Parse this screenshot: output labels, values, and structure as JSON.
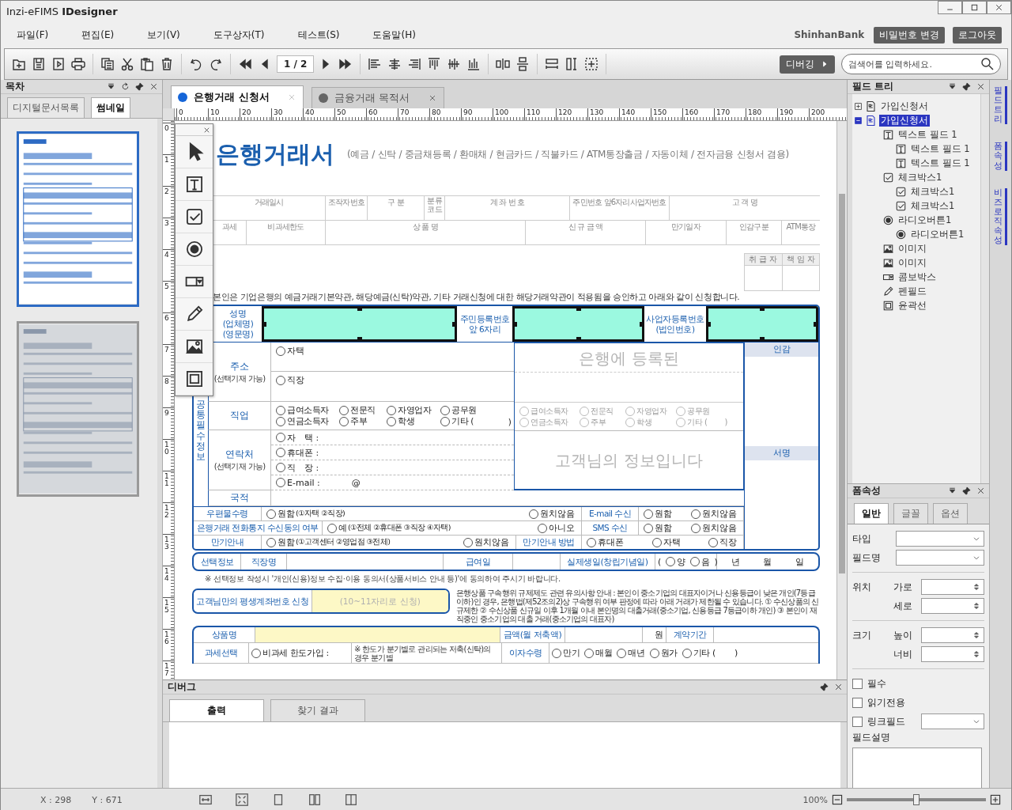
{
  "window": {
    "title": "Inzi-eFIMS **IDesigner**"
  },
  "menu": [
    "파일(F)",
    "편집(E)",
    "보기(V)",
    "도구상자(T)",
    "테스트(S)",
    "도움말(H)"
  ],
  "account": {
    "user": "ShinhanBank",
    "buttons": [
      "비밀번호 변경",
      "로그아웃"
    ]
  },
  "toolbar": {
    "page": "1 / 2",
    "debug_button": "디버깅",
    "search": {
      "placeholder": "검색어를 입력하세요."
    }
  },
  "left_panel": {
    "title": "목차",
    "tabs": [
      {
        "label": "디지털문서목록",
        "selected": false
      },
      {
        "label": "썸네일",
        "selected": true
      }
    ],
    "thumbnails": [
      {
        "selected": true
      },
      {
        "selected": false
      }
    ]
  },
  "doc_tabs": [
    {
      "label": "은행거래 신청서",
      "selected": true
    },
    {
      "label": "금융거래 목적서",
      "selected": false
    }
  ],
  "ruler": {
    "horizontal": [
      "0",
      "10",
      "20",
      "30",
      "40",
      "50",
      "60",
      "70",
      "80",
      "90",
      "100",
      "110",
      "120",
      "130",
      "140",
      "150",
      "160",
      "170",
      "180",
      "190",
      "200"
    ],
    "vertical": [
      "0",
      "1",
      "2",
      "3",
      "4",
      "5",
      "6",
      "7",
      "8",
      "9",
      "10",
      "11",
      "12",
      "13",
      "14",
      "15",
      "16",
      "17"
    ]
  },
  "document": {
    "title": "은행거래서",
    "subtitle": "(예금 / 신탁 / 중금채등록 / 환매채 / 현금카드 / 직불카드 / ATM통장출금 / 자동이체 / 전자금융 신청서 겸용)",
    "bank_use_table": [
      [
        "거래일시",
        "조작자번호",
        "구 분",
        "분류코드",
        "계 좌 번 호",
        "주민번호 앞6자리사업자번호",
        "고 객 명"
      ],
      [
        "과세",
        "비과세한도",
        "상 품 명",
        "신 규 금 액",
        "만기일자",
        "인감구분",
        "ATM통장"
      ]
    ],
    "approval": [
      "취 급 자",
      "책 임 자"
    ],
    "statement": "본인은 기업은행의 예금거래기본약관, 해당예금(신탁)약관, 기타 거래신청에 대한 해당거래약관이 적용됨을 승인하고 아래와 같이 신청합니다.",
    "identity": [
      {
        "kind": "label",
        "text": "성명\n(업체명)\n(영문명)"
      },
      {
        "kind": "field"
      },
      {
        "kind": "label",
        "text": "주민등록번호\n앞 6자리"
      },
      {
        "kind": "field"
      },
      {
        "kind": "label",
        "text": "사업자등록번호\n(법인번호)"
      },
      {
        "kind": "field"
      }
    ],
    "section_label": "공통필수정보",
    "address": {
      "label": "주소",
      "note": "(선택기재 가능)",
      "options": [
        {
          "label": "자택",
          "selected": false
        },
        {
          "label": "직장",
          "selected": false
        }
      ]
    },
    "job": {
      "label": "직업",
      "options": [
        {
          "label": "급여소득자",
          "selected": false
        },
        {
          "label": "전문직",
          "selected": false
        },
        {
          "label": "자영업자",
          "selected": false
        },
        {
          "label": "공무원",
          "selected": false
        },
        {
          "label": "연금소득자",
          "selected": false
        },
        {
          "label": "주부",
          "selected": false
        },
        {
          "label": "학생",
          "selected": false
        },
        {
          "label": "기타 (",
          "suffix": ")",
          "selected": false
        }
      ]
    },
    "contact": {
      "label": "연락처",
      "note": "(선택기재 가능)",
      "options": [
        {
          "label": "자　택 :",
          "selected": false
        },
        {
          "label": "휴대폰 :",
          "selected": false
        },
        {
          "label": "직　장 :",
          "selected": false
        },
        {
          "label": "E-mail :",
          "suffix": "@",
          "selected": false
        }
      ]
    },
    "nationality": {
      "label": "국적"
    },
    "registered_info": {
      "watermarks": [
        "은행에 등록된",
        "고객님의 정보입니다"
      ],
      "options": [
        {
          "label": "급여소득자",
          "selected": false
        },
        {
          "label": "전문직",
          "selected": false
        },
        {
          "label": "자영업자",
          "selected": false
        },
        {
          "label": "공무원",
          "selected": false
        },
        {
          "label": "연금소득자",
          "selected": false
        },
        {
          "label": "주부",
          "selected": false
        },
        {
          "label": "학생",
          "selected": false
        },
        {
          "label": "기타 (",
          "suffix": ")",
          "selected": false
        }
      ]
    },
    "seal": [
      "인감",
      "서명"
    ],
    "consent_rows": [
      {
        "cells": [
          {
            "kind": "label",
            "text": "우편물수령"
          },
          {
            "kind": "radios",
            "options": [
              {
                "label": "원함",
                "note": "(①자택 ②직장)",
                "selected": false
              },
              {
                "label": "원치않음",
                "selected": false
              }
            ]
          },
          {
            "kind": "label",
            "text": "E-mail 수신"
          },
          {
            "kind": "radios",
            "options": [
              {
                "label": "원함",
                "selected": false
              },
              {
                "label": "원치않음",
                "selected": false
              }
            ]
          }
        ]
      },
      {
        "cells": [
          {
            "kind": "label",
            "text": "은행거래 전화통지 수신동의 여부"
          },
          {
            "kind": "radios",
            "options": [
              {
                "label": "예",
                "note": "(①전체 ②휴대폰 ③직장 ④자택)",
                "selected": false
              },
              {
                "label": "아니오",
                "selected": false
              }
            ]
          },
          {
            "kind": "label",
            "text": "SMS 수신"
          },
          {
            "kind": "radios",
            "options": [
              {
                "label": "원함",
                "selected": false
              },
              {
                "label": "원치않음",
                "selected": false
              }
            ]
          }
        ]
      },
      {
        "cells": [
          {
            "kind": "label",
            "text": "만기안내"
          },
          {
            "kind": "radios",
            "options": [
              {
                "label": "원함",
                "note": "(①고객센터 ②영업점 ③전체)",
                "selected": false
              },
              {
                "label": "원치않음",
                "selected": false
              }
            ]
          },
          {
            "kind": "label",
            "text": "만기안내 방법"
          },
          {
            "kind": "radios",
            "options": [
              {
                "label": "휴대폰",
                "selected": false
              },
              {
                "label": "자택",
                "selected": false
              },
              {
                "label": "직장",
                "selected": false
              }
            ]
          }
        ]
      }
    ],
    "optional_row": [
      {
        "kind": "label",
        "text": "선택정보"
      },
      {
        "kind": "label",
        "text": "직장명"
      },
      {
        "kind": "blank"
      },
      {
        "kind": "label",
        "text": "급여일"
      },
      {
        "kind": "blank"
      },
      {
        "kind": "label",
        "text": "실제생일(창립기념일)"
      },
      {
        "kind": "radios",
        "prefix": "(",
        "suffix": ")",
        "options": [
          {
            "label": "양",
            "selected": false
          },
          {
            "label": "음",
            "selected": false
          }
        ]
      },
      {
        "kind": "date",
        "parts": [
          "년",
          "월",
          "일"
        ]
      }
    ],
    "optional_note": "※ 선택정보 작성시 '개인(신용)정보 수집·이용 동의서(상품서비스 안내 등)'에 동의하여 주시기 바랍니다.",
    "lifetime_account": {
      "label": "고객님만의 평생계좌번호 신청",
      "placeholder": "(10~11자리로 신청)"
    },
    "notice": "은행상품 구속행위 규제제도 관련 유의사항 안내 :  본인이 중소기업의 대표자이거나 신용등급이 낮은 개인(7등급 이하)인 경우, 은행법(제52조의2)상 구속행위 여부 판정에 따라 아래 거래가 제한될 수 있습니다.  ① 수신상품의 신규제한  ② 수신상품 신규일 이후 1개월 이내 본인명의 대출거래(중소기업, 신용등급 7등급이하 개인)  ③ 본인이 재직중인 중소기업의 대출 거래(중소기업의 대표자)",
    "product_rows": [
      [
        {
          "kind": "label",
          "text": "상품명"
        },
        {
          "kind": "field"
        },
        {
          "kind": "label",
          "text": "금액(월 저축액)"
        },
        {
          "kind": "blank"
        },
        {
          "kind": "text",
          "text": "원"
        },
        {
          "kind": "label",
          "text": "계약기간"
        },
        {
          "kind": "blank"
        }
      ],
      [
        {
          "kind": "label",
          "text": "과세선택"
        },
        {
          "kind": "radios",
          "options": [
            {
              "label": "비과세 한도가입 :",
              "selected": false
            }
          ]
        },
        {
          "kind": "note",
          "text": "※ 한도가 분기별로 관리되는 저축(신탁)의 경우 분기별"
        },
        {
          "kind": "label",
          "text": "이자수령"
        },
        {
          "kind": "radios",
          "options": [
            {
              "label": "만기",
              "selected": false
            },
            {
              "label": "매월",
              "selected": false
            },
            {
              "label": "매년",
              "selected": false
            },
            {
              "label": "원가",
              "selected": false
            },
            {
              "label": "기타 (",
              "suffix": ")",
              "selected": false
            }
          ]
        }
      ]
    ]
  },
  "debug_panel": {
    "title": "디버그",
    "tabs": [
      {
        "label": "출력",
        "selected": true
      },
      {
        "label": "찾기 결과",
        "selected": false
      }
    ]
  },
  "field_tree": {
    "title": "필드 트리",
    "items": [
      {
        "label": "가입신청서",
        "kind": "form",
        "expanded": false,
        "selected": false
      },
      {
        "label": "가입신청서",
        "kind": "form",
        "expanded": true,
        "selected": true,
        "children": [
          {
            "label": "텍스트 필드 1",
            "kind": "text",
            "selected": false,
            "children": [
              {
                "label": "텍스트 필드 1",
                "kind": "text",
                "selected": false
              },
              {
                "label": "텍스트 필드 1",
                "kind": "text",
                "selected": false
              }
            ]
          },
          {
            "label": "체크박스1",
            "kind": "checkbox",
            "selected": false,
            "children": [
              {
                "label": "체크박스1",
                "kind": "checkbox",
                "selected": false
              },
              {
                "label": "체크박스1",
                "kind": "checkbox",
                "selected": false
              }
            ]
          },
          {
            "label": "라디오버튼1",
            "kind": "radio",
            "selected": false,
            "children": [
              {
                "label": "라디오버튼1",
                "kind": "radio",
                "selected": false
              }
            ]
          },
          {
            "label": "이미지",
            "kind": "image",
            "selected": false
          },
          {
            "label": "이미지",
            "kind": "image",
            "selected": false
          },
          {
            "label": "콤보박스",
            "kind": "combo",
            "selected": false
          },
          {
            "label": "펜필드",
            "kind": "pen",
            "selected": false
          },
          {
            "label": "윤곽선",
            "kind": "outline",
            "selected": false
          }
        ]
      }
    ]
  },
  "form_properties": {
    "title": "폼속성",
    "tabs": [
      {
        "label": "일반",
        "selected": true
      },
      {
        "label": "글꼴",
        "selected": false
      },
      {
        "label": "옵션",
        "selected": false
      }
    ],
    "sections": [
      [
        {
          "kind": "select",
          "label": "타입"
        },
        {
          "kind": "select",
          "label": "필드명"
        }
      ],
      [
        {
          "kind": "spin",
          "group": "위치",
          "label": "가로"
        },
        {
          "kind": "spin",
          "label": "세로"
        }
      ],
      [
        {
          "kind": "spin",
          "group": "크기",
          "label": "높이"
        },
        {
          "kind": "spin",
          "label": "너비"
        }
      ],
      [
        {
          "kind": "checkbox",
          "label": "필수",
          "checked": false
        },
        {
          "kind": "checkbox",
          "label": "읽기전용",
          "checked": false
        },
        {
          "kind": "checkbox_select",
          "label": "링크필드",
          "checked": false
        },
        {
          "kind": "textarea",
          "label": "필드설명"
        }
      ]
    ]
  },
  "side_tabs": [
    "필드트리",
    "폼속성",
    "비즈로직 속성"
  ],
  "status_bar": {
    "x": "X : 298",
    "y": "Y : 671",
    "zoom": "100%",
    "zoom_slider": {
      "level": 0.5
    }
  }
}
